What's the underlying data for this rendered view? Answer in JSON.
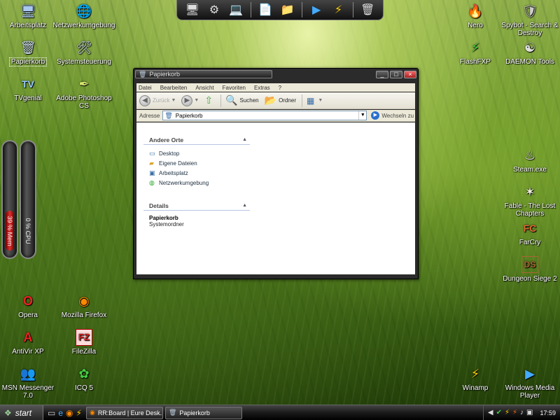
{
  "desktop": {
    "left_icons": [
      {
        "label": "Arbeitsplatz",
        "icon": "computer-icon",
        "glyph": "🖥",
        "color": "#a8c8f0"
      },
      {
        "label": "Netzwerkumgebung",
        "icon": "network-icon",
        "glyph": "🌐",
        "color": "#7fd07f"
      },
      {
        "label": "Papierkorb",
        "icon": "recycle-bin-icon",
        "glyph": "🗑",
        "color": "#c8d8e8"
      },
      {
        "label": "Systemsteuerung",
        "icon": "control-panel-icon",
        "glyph": "🛠",
        "color": "#c8d8e8"
      },
      {
        "label": "TVgenial",
        "icon": "tvgenial-icon",
        "glyph": "TV",
        "color": "#9cf"
      },
      {
        "label": "Adobe Photoshop CS",
        "icon": "photoshop-icon",
        "glyph": "✒",
        "color": "#d8e870"
      },
      {
        "label": "Opera",
        "icon": "opera-icon",
        "glyph": "O",
        "color": "#e22"
      },
      {
        "label": "Mozilla Firefox",
        "icon": "firefox-icon",
        "glyph": "◉",
        "color": "#f80"
      },
      {
        "label": "AntiVir XP",
        "icon": "antivir-icon",
        "glyph": "A",
        "color": "#e22"
      },
      {
        "label": "FileZilla",
        "icon": "filezilla-icon",
        "glyph": "FZ",
        "color": "#d22"
      },
      {
        "label": "MSN Messenger 7.0",
        "icon": "msn-messenger-icon",
        "glyph": "👥",
        "color": "#4c4"
      },
      {
        "label": "ICQ 5",
        "icon": "icq-icon",
        "glyph": "✿",
        "color": "#4c4"
      }
    ],
    "right_icons": [
      {
        "label": "Nero",
        "icon": "nero-icon",
        "glyph": "🔥",
        "color": "#f60"
      },
      {
        "label": "Spybot - Search & Destroy",
        "icon": "spybot-icon",
        "glyph": "🛡",
        "color": "#ccc"
      },
      {
        "label": "FlashFXP",
        "icon": "flashfxp-icon",
        "glyph": "⚡",
        "color": "#4c4"
      },
      {
        "label": "DAEMON Tools",
        "icon": "daemon-tools-icon",
        "glyph": "☯",
        "color": "#ddd"
      },
      {
        "label": "Steam.exe",
        "icon": "steam-icon",
        "glyph": "♨",
        "color": "#eee"
      },
      {
        "label": "Fable - The Lost Chapters",
        "icon": "fable-icon",
        "glyph": "✶",
        "color": "#eed"
      },
      {
        "label": "FarCry",
        "icon": "farcry-icon",
        "glyph": "FC",
        "color": "#d63"
      },
      {
        "label": "Dungeon Siege 2",
        "icon": "dungeon-siege-icon",
        "glyph": "DS",
        "color": "#a63"
      },
      {
        "label": "Winamp",
        "icon": "winamp-icon",
        "glyph": "⚡",
        "color": "#fc0"
      },
      {
        "label": "Windows Media Player",
        "icon": "media-player-icon",
        "glyph": "▶",
        "color": "#4af"
      }
    ]
  },
  "gauges": {
    "mem_label": "39 % Mem",
    "mem_fraction": 0.39,
    "cpu_label": "0 % CPU",
    "cpu_fraction": 0.0
  },
  "window": {
    "title": "Papierkorb",
    "minimize": "_",
    "maximize": "□",
    "close": "×",
    "menu": [
      "Datei",
      "Bearbeiten",
      "Ansicht",
      "Favoriten",
      "Extras",
      "?"
    ],
    "toolbar": {
      "back": "Zurück",
      "search": "Suchen",
      "folders": "Ordner"
    },
    "address": {
      "label": "Adresse",
      "value": "Papierkorb",
      "go": "Wechseln zu"
    },
    "other_places": {
      "header": "Andere Orte",
      "items": [
        {
          "label": "Desktop",
          "icon": "desktop-icon"
        },
        {
          "label": "Eigene Dateien",
          "icon": "my-documents-icon"
        },
        {
          "label": "Arbeitsplatz",
          "icon": "computer-icon"
        },
        {
          "label": "Netzwerkumgebung",
          "icon": "network-icon"
        }
      ]
    },
    "details": {
      "header": "Details",
      "title": "Papierkorb",
      "subtitle": "Systemordner"
    }
  },
  "taskbar": {
    "start": "start",
    "tasks": [
      {
        "label": "RR:Board | Eure Desk...",
        "icon": "firefox-icon"
      },
      {
        "label": "Papierkorb",
        "icon": "folder-icon"
      }
    ],
    "clock": "17:59"
  }
}
